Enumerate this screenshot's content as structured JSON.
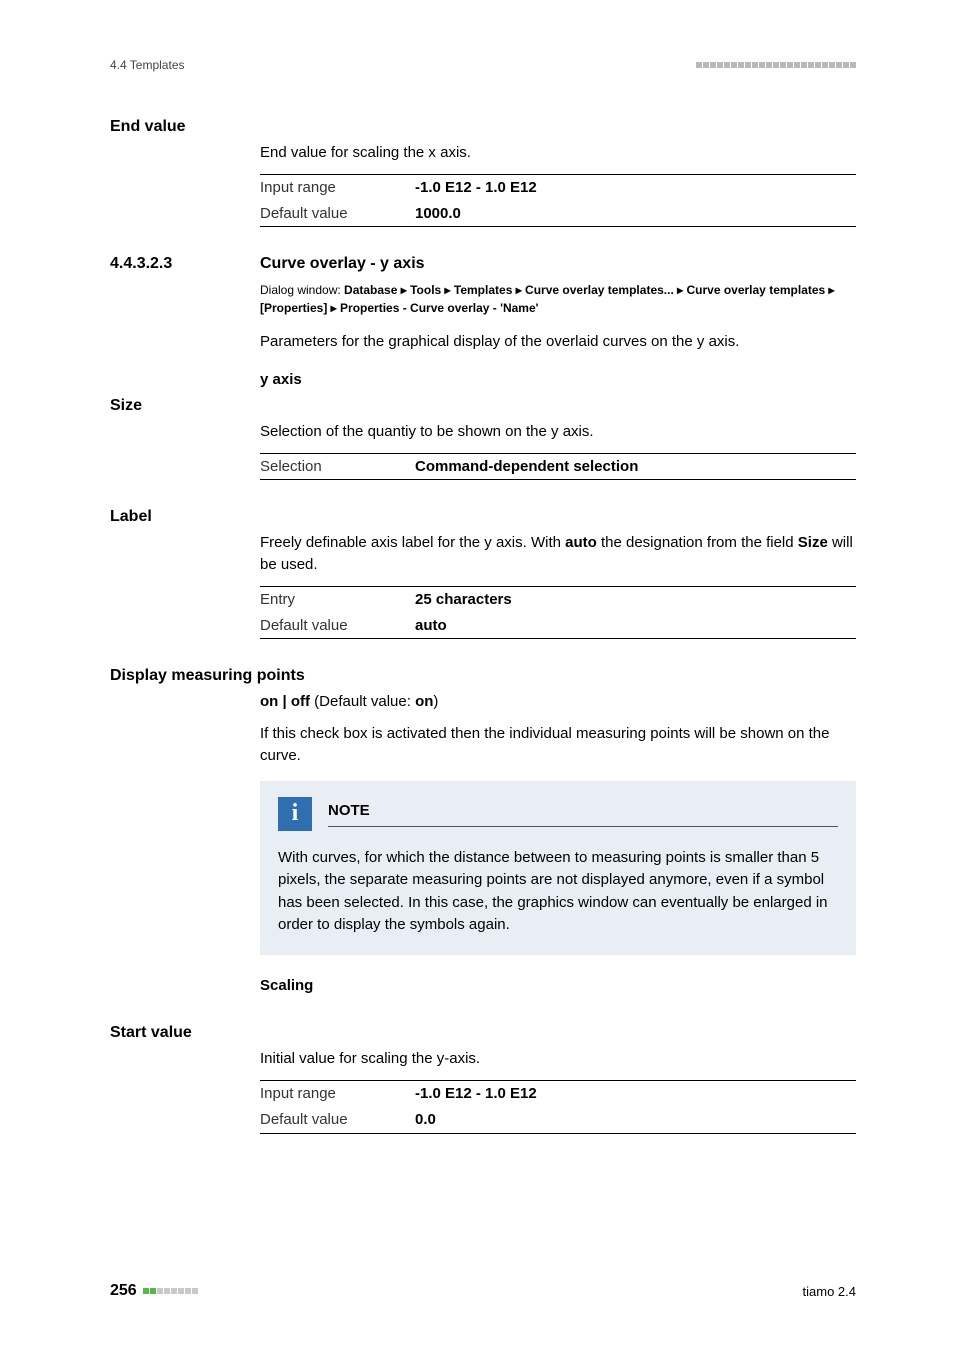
{
  "header": {
    "section_ref": "4.4 Templates"
  },
  "end_value": {
    "label": "End value",
    "desc": "End value for scaling the x axis.",
    "rows": [
      {
        "k": "Input range",
        "v": "-1.0 E12 - 1.0 E12"
      },
      {
        "k": "Default value",
        "v": "1000.0"
      }
    ]
  },
  "section": {
    "num": "4.4.3.2.3",
    "title": "Curve overlay - y axis",
    "dialog_prefix": "Dialog window: ",
    "dialog_path": "Database ▸ Tools ▸ Templates ▸ Curve overlay templates... ▸ Curve overlay templates ▸ [Properties] ▸ Properties - Curve overlay - 'Name'",
    "intro": "Parameters for the graphical display of the overlaid curves on the y axis.",
    "yaxis_head": "y axis"
  },
  "size": {
    "label": "Size",
    "desc": "Selection of the quantiy to be shown on the y axis.",
    "rows": [
      {
        "k": "Selection",
        "v": "Command-dependent selection"
      }
    ]
  },
  "label_field": {
    "label": "Label",
    "desc_pre": "Freely definable axis label for the y axis. With ",
    "desc_b1": "auto",
    "desc_mid": " the designation from the field ",
    "desc_b2": "Size",
    "desc_post": " will be used.",
    "rows": [
      {
        "k": "Entry",
        "v": "25 characters"
      },
      {
        "k": "Default value",
        "v": "auto"
      }
    ]
  },
  "measuring": {
    "label": "Display measuring points",
    "onoff_pre": "on | off",
    "onoff_mid": " (Default value: ",
    "onoff_val": "on",
    "onoff_post": ")",
    "desc": "If this check box is activated then the individual measuring points will be shown on the curve."
  },
  "note": {
    "title": "NOTE",
    "body": "With curves, for which the distance between to measuring points is smaller than 5 pixels, the separate measuring points are not displayed anymore, even if a symbol has been selected. In this case, the graphics window can eventually be enlarged in order to display the symbols again."
  },
  "scaling": {
    "head": "Scaling"
  },
  "start_value": {
    "label": "Start value",
    "desc": "Initial value for scaling the y-axis.",
    "rows": [
      {
        "k": "Input range",
        "v": "-1.0 E12 - 1.0 E12"
      },
      {
        "k": "Default value",
        "v": "0.0"
      }
    ]
  },
  "footer": {
    "page": "256",
    "product": "tiamo 2.4"
  }
}
